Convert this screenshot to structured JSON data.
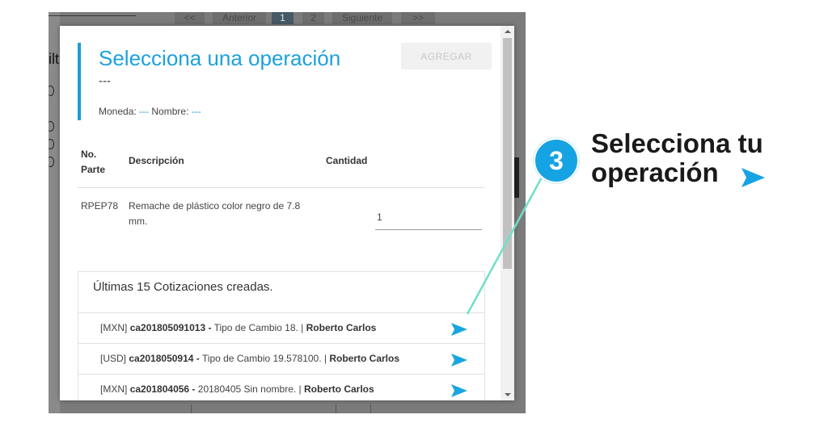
{
  "background": {
    "pager": {
      "prev_prev": "<<",
      "prev": "Anterior",
      "page_1": "1",
      "page_2": "2",
      "next": "Siguiente",
      "next_next": ">>"
    },
    "partial_letters": "ilt"
  },
  "modal": {
    "title": "Selecciona una operación",
    "subtitle": "---",
    "meta": {
      "moneda_label": "Moneda:",
      "moneda_value": "---",
      "nombre_label": "Nombre:",
      "nombre_value": "---"
    },
    "add_button": "AGREGAR",
    "table": {
      "headers": {
        "part_line1": "No.",
        "part_line2": "Parte",
        "description": "Descripción",
        "quantity": "Cantidad"
      },
      "rows": [
        {
          "part": "RPEP78",
          "description_line1": "Remache de plástico color negro de 7.8",
          "description_line2": "mm.",
          "quantity": "1"
        }
      ]
    },
    "quotes": {
      "title": "Últimas 15 Cotizaciones creadas.",
      "items": [
        {
          "currency": "[MXN]",
          "code": "ca201805091013 -",
          "detail": " Tipo de Cambio 18. | ",
          "user": "Roberto Carlos"
        },
        {
          "currency": "[USD]",
          "code": "ca2018050914 -",
          "detail": " Tipo de Cambio 19.578100. | ",
          "user": "Roberto Carlos"
        },
        {
          "currency": "[MXN]",
          "code": "ca201804056 -",
          "detail": " 20180405 Sin nombre. | ",
          "user": "Roberto Carlos"
        }
      ]
    }
  },
  "callout": {
    "step_number": "3",
    "line1": "Selecciona tu",
    "line2": "operación",
    "accent_color": "#16a3e3",
    "connector_color": "#6fe0c8"
  },
  "icons": {
    "send": "send-arrow-icon",
    "callout_arrow": "send-arrow-icon"
  }
}
